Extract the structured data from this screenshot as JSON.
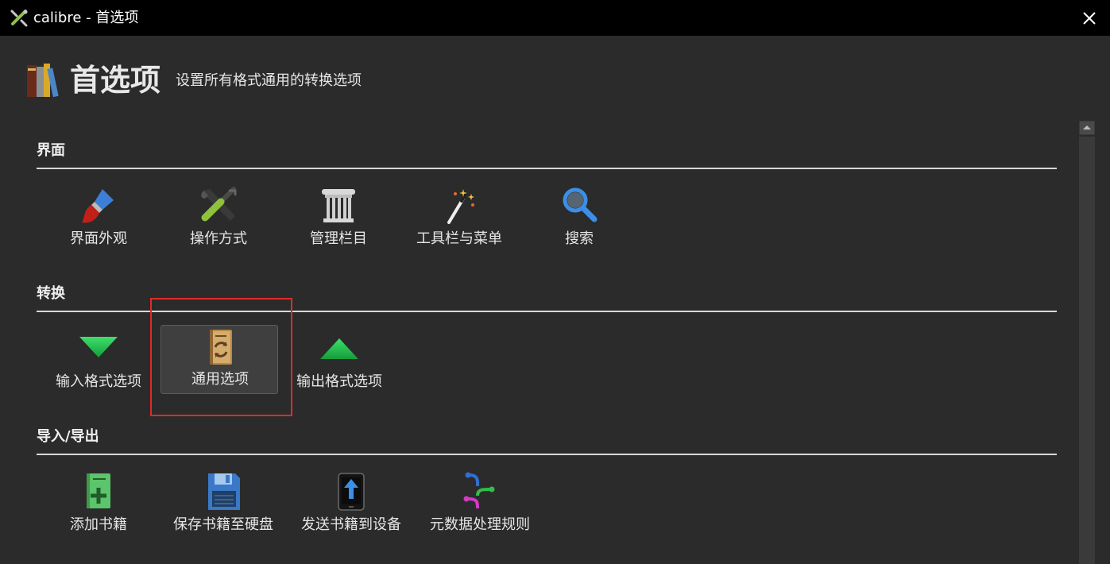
{
  "window": {
    "title": "calibre - 首选项"
  },
  "header": {
    "title": "首选项",
    "subtitle": "设置所有格式通用的转换选项"
  },
  "sections": [
    {
      "title": "界面",
      "items": [
        {
          "label": "界面外观",
          "icon": "paintbrush-icon"
        },
        {
          "label": "操作方式",
          "icon": "tools-icon"
        },
        {
          "label": "管理栏目",
          "icon": "column-icon"
        },
        {
          "label": "工具栏与菜单",
          "icon": "magic-wand-icon"
        },
        {
          "label": "搜索",
          "icon": "search-icon"
        }
      ]
    },
    {
      "title": "转换",
      "items": [
        {
          "label": "输入格式选项",
          "icon": "arrow-down-icon"
        },
        {
          "label": "通用选项",
          "icon": "book-convert-icon",
          "selected": true
        },
        {
          "label": "输出格式选项",
          "icon": "arrow-up-icon"
        }
      ]
    },
    {
      "title": "导入/导出",
      "items": [
        {
          "label": "添加书籍",
          "icon": "add-book-icon"
        },
        {
          "label": "保存书籍至硬盘",
          "icon": "save-disk-icon"
        },
        {
          "label": "发送书籍到设备",
          "icon": "send-device-icon"
        },
        {
          "label": "元数据处理规则",
          "icon": "metadata-rules-icon"
        }
      ]
    }
  ],
  "colors": {
    "background": "#2b2b2b",
    "titlebar": "#000000",
    "highlight": "#e02a2a"
  }
}
